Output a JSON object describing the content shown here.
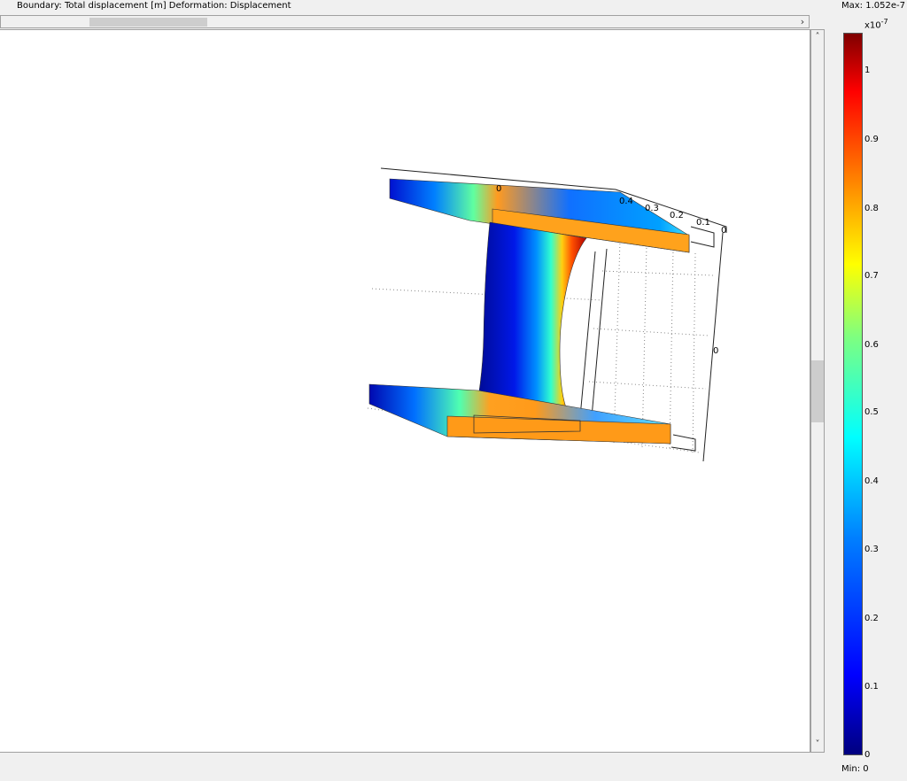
{
  "header": {
    "title": "Boundary: Total displacement [m]   Deformation: Displacement"
  },
  "scrollbars": {
    "left_arrow": "<",
    "right_arrow": ">",
    "up_arrow": "^",
    "down_arrow": "v"
  },
  "axes": {
    "ticks_top": [
      "0.4",
      "0.3",
      "0.2",
      "0.1",
      "0"
    ],
    "tick_front_top": "0",
    "tick_right": "0"
  },
  "colorbar": {
    "max_label": "Max: 1.052e-7",
    "min_label": "Min: 0",
    "exponent_base": "x10",
    "exponent_power": "-7",
    "ticks": [
      "1",
      "0.9",
      "0.8",
      "0.7",
      "0.6",
      "0.5",
      "0.4",
      "0.3",
      "0.2",
      "0.1",
      "0"
    ],
    "colormap": "jet",
    "colors": [
      "#00007f",
      "#0000ff",
      "#007fff",
      "#00ffff",
      "#7fff7f",
      "#ffff00",
      "#ff7f00",
      "#ff0000",
      "#7f0000"
    ]
  }
}
